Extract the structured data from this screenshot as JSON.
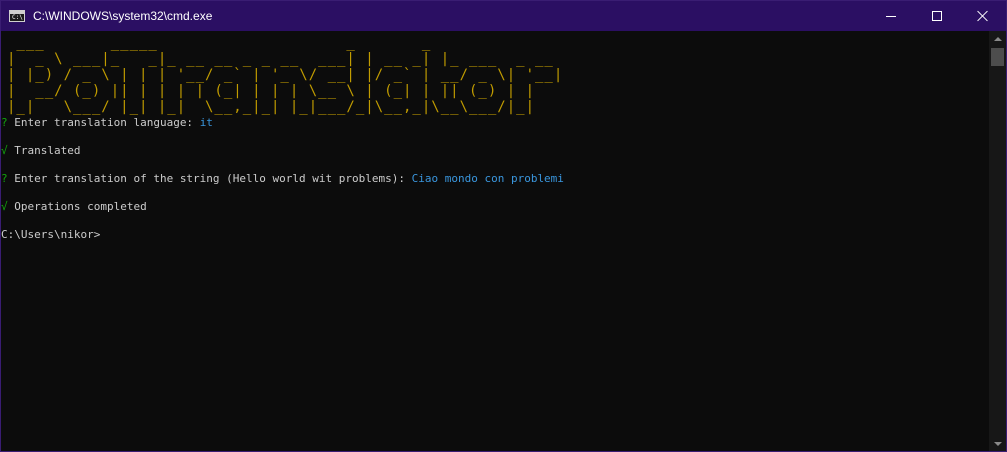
{
  "window": {
    "title": "C:\\WINDOWS\\system32\\cmd.exe",
    "icon": "cmd-icon",
    "icon_text": "C:\\"
  },
  "controls": {
    "minimize": "minimize-icon",
    "maximize": "maximize-icon",
    "close": "close-icon"
  },
  "console": {
    "banner": " ___       _____                    _       _\n|  _ \\ ___|_   _|_ __ __ _ _ __  ___| | __ _| |_ ___  _ __\n| |_) / _ \\ | | | '__/ _` | '_ \\/ __| |/ _` | __/ _ \\| '__|\n|  __/ (_) || | | | | (_| | | | \\__ \\ | (_| | || (_) | |\n|_|   \\___/ |_| |_|  \\__,_|_| |_|___/_|\\__,_|\\__\\___/|_|",
    "lines": [
      {
        "prefix": "?",
        "text": "Enter translation language:",
        "answer": "it"
      },
      {
        "prefix": "√",
        "text": "Translated"
      },
      {
        "prefix": "?",
        "text": "Enter translation of the string (Hello world wit problems):",
        "answer": "Ciao mondo con problemi"
      },
      {
        "prefix": "√",
        "text": "Operations completed"
      }
    ],
    "prompt": "C:\\Users\\nikor>"
  },
  "colors": {
    "titlebar": "#2b0f63",
    "banner": "#c19c00",
    "prefix": "#13a10e",
    "answer": "#3a96dd",
    "text": "#cccccc",
    "background": "#0c0c0c"
  }
}
